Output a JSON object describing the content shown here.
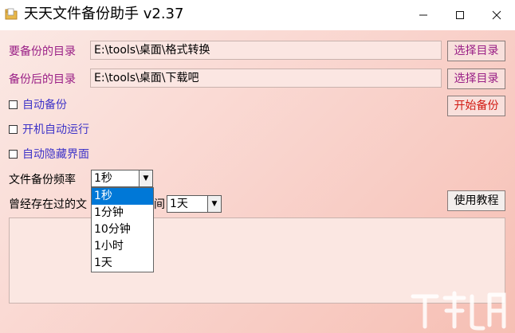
{
  "window": {
    "title": "天天文件备份助手 v2.37"
  },
  "source": {
    "label": "要备份的目录",
    "path": "E:\\tools\\桌面\\格式转换",
    "button": "选择目录"
  },
  "target": {
    "label": "备份后的目录",
    "path": "E:\\tools\\桌面\\下载吧",
    "button": "选择目录"
  },
  "options": {
    "auto_backup": "自动备份",
    "auto_start": "开机自动运行",
    "auto_hide": "自动隐藏界面"
  },
  "start_button": "开始备份",
  "frequency": {
    "label": "文件备份频率",
    "selected": "1秒",
    "options": [
      "1秒",
      "1分钟",
      "10分钟",
      "1小时",
      "1天"
    ]
  },
  "retention": {
    "label_left": "曾经存在过的文",
    "label_right": "间",
    "selected": "1天"
  },
  "help_button": "使用教程",
  "colors": {
    "label_purple": "#9a1f86",
    "check_label_blue": "#3f34c8",
    "start_red": "#d21a12",
    "selected_item": "#0078d7"
  }
}
